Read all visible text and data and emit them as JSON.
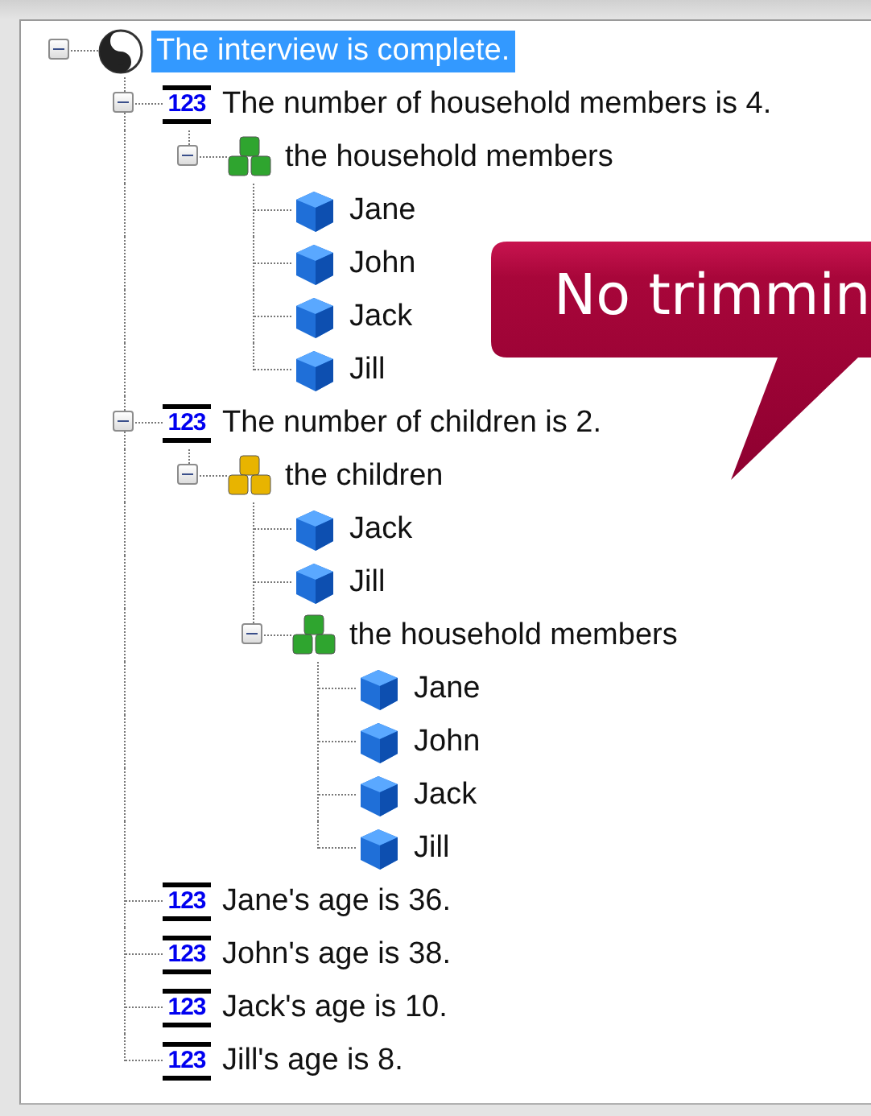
{
  "tree": [
    {
      "kind": "root",
      "label": "The interview is complete.",
      "selected": true,
      "expanded": true,
      "children": [
        {
          "kind": "number",
          "badge": "123",
          "label": "The number of household members is 4.",
          "selected": false,
          "expanded": true,
          "children": [
            {
              "kind": "group",
              "color": "#2fa52f",
              "label": "the household members",
              "selected": false,
              "expanded": true,
              "children": [
                {
                  "kind": "person",
                  "label": "Jane",
                  "selected": false
                },
                {
                  "kind": "person",
                  "label": "John",
                  "selected": false
                },
                {
                  "kind": "person",
                  "label": "Jack",
                  "selected": false
                },
                {
                  "kind": "person",
                  "label": "Jill",
                  "selected": false
                }
              ]
            }
          ]
        },
        {
          "kind": "number",
          "badge": "123",
          "label": "The number of children is 2.",
          "selected": false,
          "expanded": true,
          "children": [
            {
              "kind": "group",
              "color": "#e8b400",
              "label": "the children",
              "selected": false,
              "expanded": true,
              "children": [
                {
                  "kind": "person",
                  "label": "Jack",
                  "selected": false
                },
                {
                  "kind": "person",
                  "label": "Jill",
                  "selected": false
                },
                {
                  "kind": "group",
                  "color": "#2fa52f",
                  "label": "the household members",
                  "selected": false,
                  "expanded": true,
                  "children": [
                    {
                      "kind": "person",
                      "label": "Jane",
                      "selected": false
                    },
                    {
                      "kind": "person",
                      "label": "John",
                      "selected": false
                    },
                    {
                      "kind": "person",
                      "label": "Jack",
                      "selected": false
                    },
                    {
                      "kind": "person",
                      "label": "Jill",
                      "selected": false
                    }
                  ]
                }
              ]
            }
          ]
        },
        {
          "kind": "number",
          "badge": "123",
          "label": "Jane's age is 36.",
          "selected": false
        },
        {
          "kind": "number",
          "badge": "123",
          "label": "John's age is 38.",
          "selected": false
        },
        {
          "kind": "number",
          "badge": "123",
          "label": "Jack's age is 10.",
          "selected": false
        },
        {
          "kind": "number",
          "badge": "123",
          "label": "Jill's age is 8.",
          "selected": false
        }
      ]
    }
  ],
  "callout": {
    "text": "No trimmin"
  }
}
